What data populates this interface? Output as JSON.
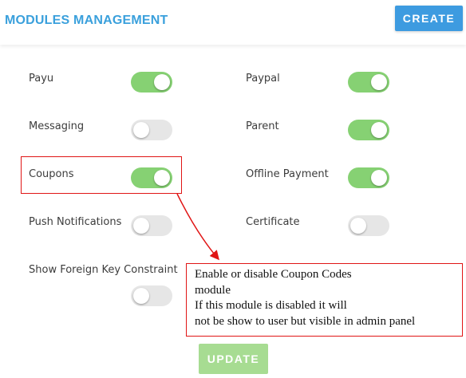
{
  "header": {
    "title": "MODULES MANAGEMENT",
    "create_label": "CREATE"
  },
  "modules": [
    {
      "label": "Payu",
      "enabled": true
    },
    {
      "label": "Paypal",
      "enabled": true
    },
    {
      "label": "Messaging",
      "enabled": false
    },
    {
      "label": "Parent",
      "enabled": true
    },
    {
      "label": "Coupons",
      "enabled": true
    },
    {
      "label": "Offline Payment",
      "enabled": true
    },
    {
      "label": "Push Notifications",
      "enabled": false
    },
    {
      "label": "Certificate",
      "enabled": false
    },
    {
      "label": "Show Foreign Key Constraint",
      "enabled": false
    }
  ],
  "annotation": {
    "lines": [
      "Enable or disable Coupon Codes",
      "module",
      "If this module is disabled it will",
      "not be show to user but visible in admin panel"
    ],
    "color": "#e01515"
  },
  "footer": {
    "update_label": "UPDATE"
  }
}
